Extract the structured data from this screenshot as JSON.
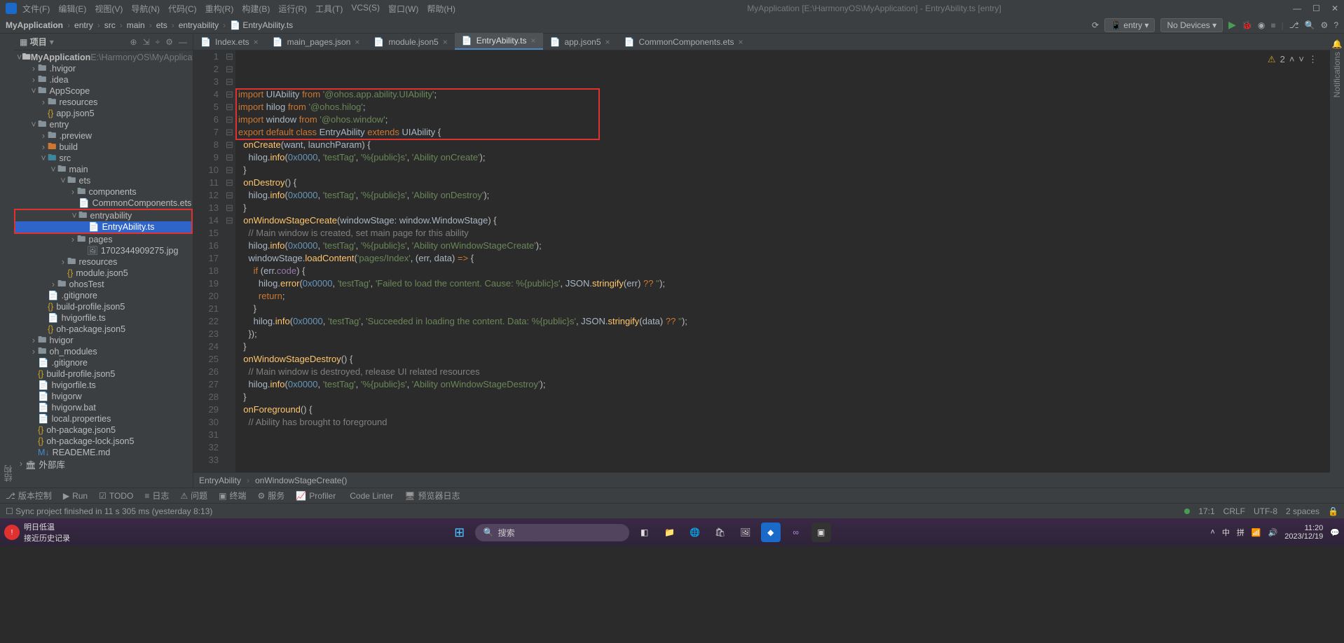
{
  "window": {
    "title": "MyApplication [E:\\HarmonyOS\\MyApplication] - EntryAbility.ts [entry]"
  },
  "menu": [
    "文件(F)",
    "编辑(E)",
    "视图(V)",
    "导航(N)",
    "代码(C)",
    "重构(R)",
    "构建(B)",
    "运行(R)",
    "工具(T)",
    "VCS(S)",
    "窗口(W)",
    "帮助(H)"
  ],
  "breadcrumb": [
    "MyApplication",
    "entry",
    "src",
    "main",
    "ets",
    "entryability",
    "EntryAbility.ts"
  ],
  "entry_selector": "entry",
  "device_selector": "No Devices",
  "panel": {
    "title": "项目"
  },
  "tree": {
    "root": "MyApplication",
    "root_path": "E:\\HarmonyOS\\MyApplicatio",
    "items": [
      {
        "d": 1,
        "t": "f",
        "n": ".hvigor"
      },
      {
        "d": 1,
        "t": "f",
        "n": ".idea"
      },
      {
        "d": 1,
        "t": "fo",
        "n": "AppScope"
      },
      {
        "d": 2,
        "t": "f",
        "n": "resources"
      },
      {
        "d": 2,
        "t": "j",
        "n": "app.json5"
      },
      {
        "d": 1,
        "t": "mo",
        "n": "entry"
      },
      {
        "d": 2,
        "t": "f",
        "n": ".preview"
      },
      {
        "d": 2,
        "t": "f",
        "n": "build",
        "cls": "mod"
      },
      {
        "d": 2,
        "t": "fo",
        "n": "src",
        "cls": "src"
      },
      {
        "d": 3,
        "t": "fo",
        "n": "main"
      },
      {
        "d": 4,
        "t": "fo",
        "n": "ets"
      },
      {
        "d": 5,
        "t": "f",
        "n": "components"
      },
      {
        "d": 6,
        "t": "e",
        "n": "CommonComponents.ets"
      },
      {
        "d": 5,
        "t": "fo",
        "n": "entryability",
        "box": "start"
      },
      {
        "d": 6,
        "t": "e",
        "n": "EntryAbility.ts",
        "sel": true,
        "box": "end"
      },
      {
        "d": 5,
        "t": "f",
        "n": "pages"
      },
      {
        "d": 6,
        "t": "i",
        "n": "1702344909275.jpg"
      },
      {
        "d": 4,
        "t": "f",
        "n": "resources"
      },
      {
        "d": 4,
        "t": "j",
        "n": "module.json5"
      },
      {
        "d": 3,
        "t": "f",
        "n": "ohosTest"
      },
      {
        "d": 2,
        "t": "g",
        "n": ".gitignore"
      },
      {
        "d": 2,
        "t": "j",
        "n": "build-profile.json5"
      },
      {
        "d": 2,
        "t": "e",
        "n": "hvigorfile.ts"
      },
      {
        "d": 2,
        "t": "j",
        "n": "oh-package.json5"
      },
      {
        "d": 1,
        "t": "f",
        "n": "hvigor"
      },
      {
        "d": 1,
        "t": "m",
        "n": "oh_modules"
      },
      {
        "d": 1,
        "t": "g",
        "n": ".gitignore"
      },
      {
        "d": 1,
        "t": "j",
        "n": "build-profile.json5"
      },
      {
        "d": 1,
        "t": "e",
        "n": "hvigorfile.ts"
      },
      {
        "d": 1,
        "t": "x",
        "n": "hvigorw"
      },
      {
        "d": 1,
        "t": "x",
        "n": "hvigorw.bat"
      },
      {
        "d": 1,
        "t": "x",
        "n": "local.properties"
      },
      {
        "d": 1,
        "t": "j",
        "n": "oh-package.json5"
      },
      {
        "d": 1,
        "t": "j",
        "n": "oh-package-lock.json5"
      },
      {
        "d": 1,
        "t": "r",
        "n": "READEME.md"
      }
    ],
    "ext": "外部库"
  },
  "tabs": [
    {
      "label": "Index.ets"
    },
    {
      "label": "main_pages.json"
    },
    {
      "label": "module.json5"
    },
    {
      "label": "EntryAbility.ts",
      "active": true
    },
    {
      "label": "app.json5"
    },
    {
      "label": "CommonComponents.ets"
    }
  ],
  "warnings": "2",
  "code_crumb": [
    "EntryAbility",
    "onWindowStageCreate()"
  ],
  "code_lines": 33,
  "current_line": 17,
  "bottom_tools": [
    "版本控制",
    "Run",
    "TODO",
    "日志",
    "问题",
    "终端",
    "服务",
    "Profiler",
    "Code Linter",
    "预览器日志"
  ],
  "status": {
    "msg": "Sync project finished in 11 s 305 ms (yesterday 8:13)",
    "pos": "17:1",
    "eol": "CRLF",
    "enc": "UTF-8",
    "indent": "2 spaces"
  },
  "taskbar": {
    "weather1": "明日低温",
    "weather2": "接近历史记录",
    "search": "搜索",
    "ime": [
      "中",
      "拼"
    ],
    "time": "11:20",
    "date": "2023/12/19"
  }
}
